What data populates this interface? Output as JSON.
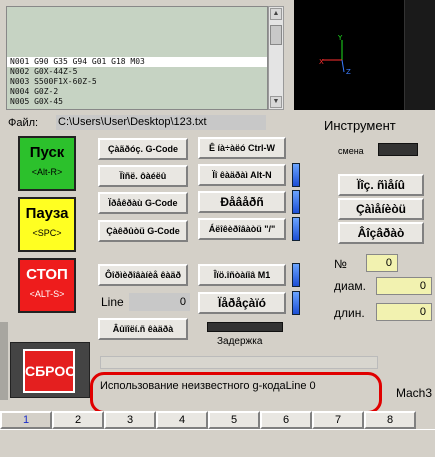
{
  "gcode_lines": [
    "N001 G90 G35 G94 G01 G18 M03",
    "N002 G0X-44Z-5",
    "N003 S500F1X-60Z-5",
    "N004 G0Z-2",
    "N005 G0X-45"
  ],
  "file": {
    "label": "Файл:",
    "path": "C:\\Users\\User\\Desktop\\123.txt"
  },
  "tool": {
    "title": "Инструмент",
    "change_label": "смена",
    "load_btn": "Ïîç. ñìåíû",
    "change_btn": "Çàìåíèòü",
    "select_btn": "Âîçâðàò"
  },
  "buttons": {
    "start": {
      "title": "Пуск",
      "key": "<Alt-R>"
    },
    "pause": {
      "title": "Пауза",
      "key": "<SPC>"
    },
    "stop": {
      "title": "СТОП",
      "key": "<ALT-S>"
    },
    "reset": "СБРОС",
    "edit_gcode": "Çàãðóç. G-Code",
    "recent_file": "Ïîñë. ôàéëû",
    "close_gcode": "Ïðåêðàù G-Code",
    "rewind_gcode": "Çàêðûòü G-Code",
    "stop_ctrl_w": "Ê íà÷àëó Ctrl-W",
    "line_alt_n": "Ïî êàäðàì Alt-N",
    "single_step": "Ðåâåðñ",
    "block_delete": "Áëîêèðîâàòü \"/\"",
    "optional_stop": "Îïö.îñòàíîâ M1",
    "flood": "Ïåðåçàïó",
    "run_from_here": "Ôîðìèðîâàíèå êàäð",
    "set_next_line": "Âûïîëí.ñ êàäðà"
  },
  "line_field": {
    "label": "Line",
    "value": "0"
  },
  "delay_label": "Задержка",
  "tool_info": {
    "num_label": "№",
    "num_value": "0",
    "diam_label": "диам.",
    "diam_value": "0",
    "len_label": "длин.",
    "len_value": "0"
  },
  "message": "Использование неизвестного g-кодаLine 0",
  "mach_label": "Mach3",
  "tabs": [
    "1",
    "2",
    "3",
    "4",
    "5",
    "6",
    "7",
    "8"
  ],
  "colors": {
    "start": "#2cc12c",
    "pause": "#ffff22",
    "stop": "#ee1c1c",
    "message_border": "#e00000"
  }
}
